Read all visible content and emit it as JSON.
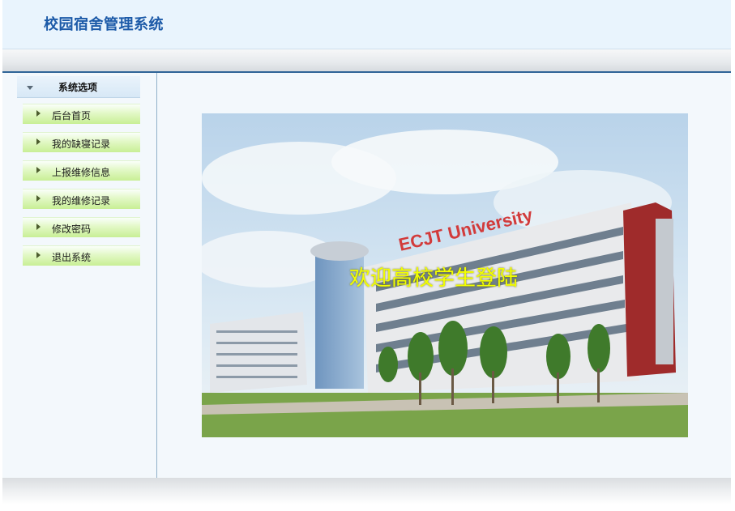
{
  "app": {
    "title": "校园宿舍管理系统"
  },
  "sidebar": {
    "heading": "系统选项",
    "items": [
      {
        "label": "后台首页"
      },
      {
        "label": "我的缺寝记录"
      },
      {
        "label": "上报维修信息"
      },
      {
        "label": "我的维修记录"
      },
      {
        "label": "修改密码"
      },
      {
        "label": "退出系统"
      }
    ]
  },
  "main": {
    "welcome_text": "欢迎高校学生登陆",
    "banner_sign": "ECJT University"
  },
  "colors": {
    "title": "#1c5aa8",
    "welcome": "#f2ff00",
    "menu_green": "#c8ef95"
  },
  "icons": {
    "menu_collapse": "triangle-down-icon",
    "menu_item": "triangle-right-icon"
  }
}
